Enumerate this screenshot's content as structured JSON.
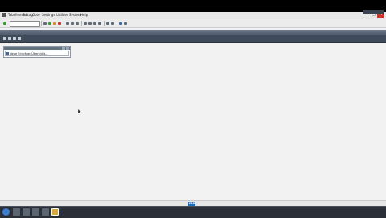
{
  "menubar": {
    "items": [
      "Tabelleneintrag",
      "Edit",
      "Goto",
      "Settings",
      "Utilities",
      "System",
      "Help"
    ]
  },
  "title": {
    "text": ""
  },
  "panel": {
    "row_label": "Neue Einträge: Übersicht..."
  },
  "status": {
    "left_text": "",
    "sap_logo": "SAP",
    "right_text": ""
  },
  "tray": {
    "time": ""
  }
}
